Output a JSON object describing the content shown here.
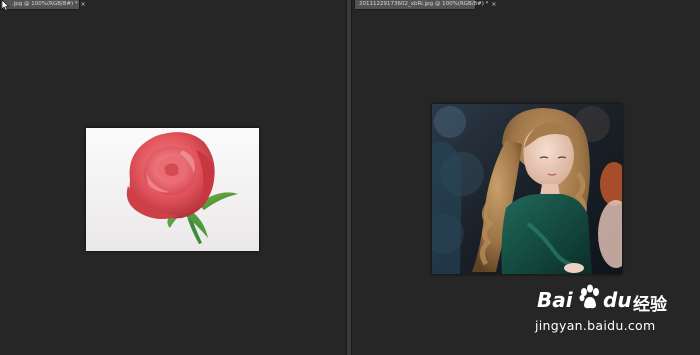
{
  "left_document": {
    "tab_title": ".jpg @ 100%(RGB/8#) *",
    "close_glyph": "×"
  },
  "right_document": {
    "tab_title": "20111229173602_xbRi.jpg @ 100%(RGB/8#) *",
    "close_glyph": "×"
  },
  "watermark": {
    "brand_prefix": "Bai",
    "brand_suffix": "du",
    "product": "经验",
    "url": "jingyan.baidu.com"
  },
  "colors": {
    "workspace_bg": "#262626",
    "tab_bg": "#535353",
    "rose": "#e2545c",
    "rose_canvas": "#f2f0f1"
  }
}
